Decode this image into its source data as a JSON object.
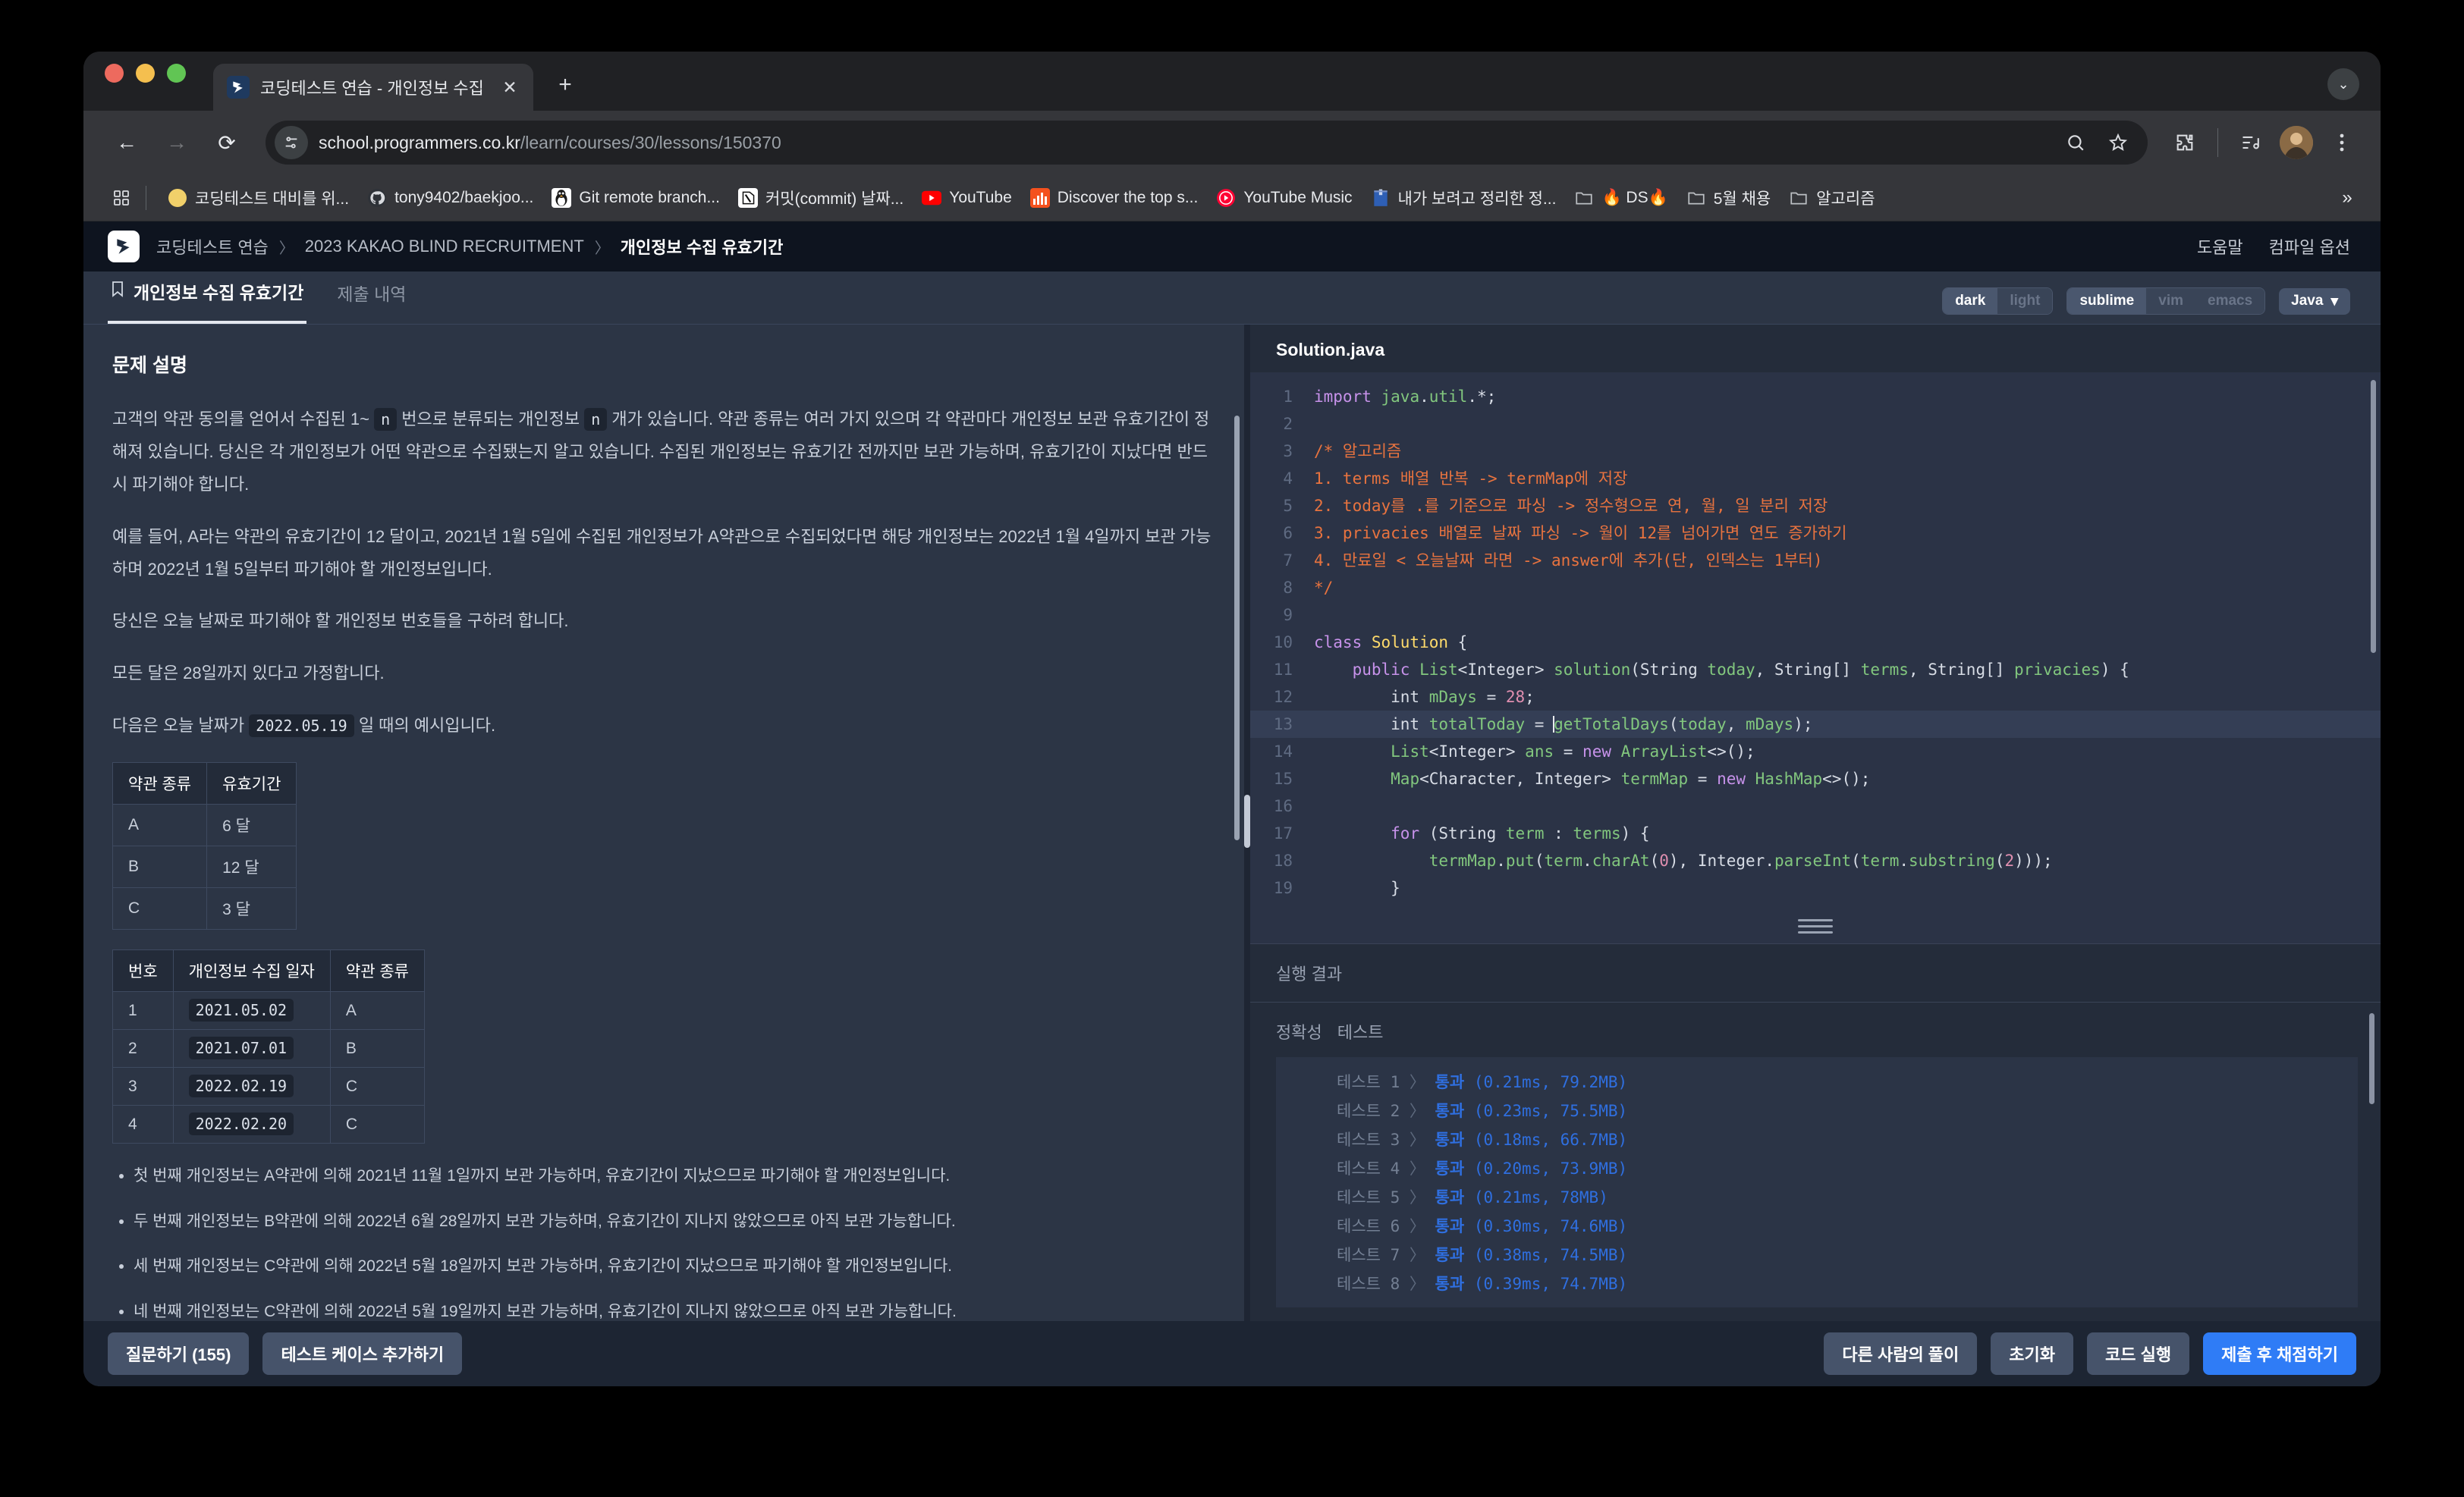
{
  "browser": {
    "tab": {
      "title": "코딩테스트 연습 - 개인정보 수집 유",
      "favicon": "programmers-favicon",
      "close": "✕"
    },
    "newtab_label": "+",
    "tabstrip_more": "⌄",
    "nav": {
      "back": "←",
      "forward": "→",
      "reload": "⟳"
    },
    "omnibox": {
      "host": "school.programmers.co.kr",
      "path": "/learn/courses/30/lessons/150370",
      "site_icon": "site-settings-icon",
      "zoom_icon": "search-icon",
      "bookmark_icon": "star-icon"
    },
    "toolbar_icons": {
      "extensions": "puzzle-icon",
      "media": "media-controls-icon",
      "profile": "avatar-icon",
      "menu": "three-dot-menu-icon"
    },
    "bookmarks": [
      {
        "label": "코딩테스트 대비를 위...",
        "icon": "yellow-circle-icon"
      },
      {
        "label": "tony9402/baekjoo...",
        "icon": "github-icon"
      },
      {
        "label": "Git remote branch...",
        "icon": "tux-icon"
      },
      {
        "label": "커밋(commit) 날짜...",
        "icon": "notion-icon"
      },
      {
        "label": "YouTube",
        "icon": "youtube-icon"
      },
      {
        "label": "Discover the top s...",
        "icon": "orange-chart-icon"
      },
      {
        "label": "YouTube Music",
        "icon": "youtube-music-icon"
      },
      {
        "label": "내가 보려고 정리한 정...",
        "icon": "blue-book-icon"
      },
      {
        "label": "🔥 DS🔥",
        "icon": "folder-icon"
      },
      {
        "label": "5월 채용",
        "icon": "folder-icon"
      },
      {
        "label": "알고리즘",
        "icon": "folder-icon"
      }
    ],
    "bookmarks_overflow": "»",
    "apps_icon": "apps-grid-icon"
  },
  "site": {
    "logo": "programmers-logo",
    "breadcrumb": [
      "코딩테스트 연습",
      "2023 KAKAO BLIND RECRUITMENT",
      "개인정보 수집 유효기간"
    ],
    "breadcrumb_sep": "〉",
    "header_links": [
      "도움말",
      "컴파일 옵션"
    ]
  },
  "page_tabs": [
    {
      "label": "개인정보 수집 유효기간",
      "active": true,
      "icon": "bookmark-icon"
    },
    {
      "label": "제출 내역",
      "active": false
    }
  ],
  "settings": {
    "theme": {
      "options": [
        "dark",
        "light"
      ],
      "selected": "dark"
    },
    "keymap": {
      "options": [
        "sublime",
        "vim",
        "emacs"
      ],
      "selected": "sublime"
    },
    "language": {
      "selected": "Java",
      "caret": "▾"
    }
  },
  "problem": {
    "section_title": "문제 설명",
    "paragraphs": [
      "고객의 약관 동의를 얻어서 수집된 1~ n 번으로 분류되는 개인정보 n 개가 있습니다. 약관 종류는 여러 가지 있으며 각 약관마다 개인정보 보관 유효기간이 정해져 있습니다. 당신은 각 개인정보가 어떤 약관으로 수집됐는지 알고 있습니다. 수집된 개인정보는 유효기간 전까지만 보관 가능하며, 유효기간이 지났다면 반드시 파기해야 합니다.",
      "예를 들어, A라는 약관의 유효기간이 12 달이고, 2021년 1월 5일에 수집된 개인정보가 A약관으로 수집되었다면 해당 개인정보는 2022년 1월 4일까지 보관 가능하며 2022년 1월 5일부터 파기해야 할 개인정보입니다.",
      "당신은 오늘 날짜로 파기해야 할 개인정보 번호들을 구하려 합니다.",
      "모든 달은 28일까지 있다고 가정합니다."
    ],
    "inline_n": "n",
    "example_intro_before": "다음은 오늘 날짜가",
    "example_date": "2022.05.19",
    "example_intro_after": "일 때의 예시입니다.",
    "terms_table": {
      "headers": [
        "약관 종류",
        "유효기간"
      ],
      "rows": [
        [
          "A",
          "6 달"
        ],
        [
          "B",
          "12 달"
        ],
        [
          "C",
          "3 달"
        ]
      ]
    },
    "privacy_table": {
      "headers": [
        "번호",
        "개인정보 수집 일자",
        "약관 종류"
      ],
      "rows": [
        [
          "1",
          "2021.05.02",
          "A"
        ],
        [
          "2",
          "2021.07.01",
          "B"
        ],
        [
          "3",
          "2022.02.19",
          "C"
        ],
        [
          "4",
          "2022.02.20",
          "C"
        ]
      ]
    },
    "notes": [
      "첫 번째 개인정보는 A약관에 의해 2021년 11월 1일까지 보관 가능하며, 유효기간이 지났으므로 파기해야 할 개인정보입니다.",
      "두 번째 개인정보는 B약관에 의해 2022년 6월 28일까지 보관 가능하며, 유효기간이 지나지 않았으므로 아직 보관 가능합니다.",
      "세 번째 개인정보는 C약관에 의해 2022년 5월 18일까지 보관 가능하며, 유효기간이 지났으므로 파기해야 할 개인정보입니다.",
      "네 번째 개인정보는 C약관에 의해 2022년 5월 19일까지 보관 가능하며, 유효기간이 지나지 않았으므로 아직 보관 가능합니다."
    ]
  },
  "editor": {
    "filename": "Solution.java",
    "highlighted_line": 13,
    "lines": [
      {
        "n": 1,
        "tokens": [
          {
            "t": "import ",
            "c": "k"
          },
          {
            "t": "java",
            "c": "t"
          },
          {
            "t": ".",
            "c": "pl"
          },
          {
            "t": "util",
            "c": "t"
          },
          {
            "t": ".*;",
            "c": "pl"
          }
        ]
      },
      {
        "n": 2,
        "tokens": []
      },
      {
        "n": 3,
        "tokens": [
          {
            "t": "/* 알고리즘",
            "c": "cm"
          }
        ]
      },
      {
        "n": 4,
        "tokens": [
          {
            "t": "1. terms 배열 반복 -> termMap에 저장",
            "c": "cm"
          }
        ]
      },
      {
        "n": 5,
        "tokens": [
          {
            "t": "2. today를 .를 기준으로 파싱 -> 정수형으로 연, 월, 일 분리 저장",
            "c": "cm"
          }
        ]
      },
      {
        "n": 6,
        "tokens": [
          {
            "t": "3. privacies 배열로 날짜 파싱 -> 월이 12를 넘어가면 연도 증가하기",
            "c": "cm"
          }
        ]
      },
      {
        "n": 7,
        "tokens": [
          {
            "t": "4. 만료일 < 오늘날짜 라면 -> answer에 추가(단, 인덱스는 1부터)",
            "c": "cm"
          }
        ]
      },
      {
        "n": 8,
        "tokens": [
          {
            "t": "*/",
            "c": "cm"
          }
        ]
      },
      {
        "n": 9,
        "tokens": []
      },
      {
        "n": 10,
        "tokens": [
          {
            "t": "class ",
            "c": "k"
          },
          {
            "t": "Solution",
            "c": "cls"
          },
          {
            "t": " {",
            "c": "pl"
          }
        ]
      },
      {
        "n": 11,
        "tokens": [
          {
            "t": "    ",
            "c": "pl"
          },
          {
            "t": "public ",
            "c": "k"
          },
          {
            "t": "List",
            "c": "t"
          },
          {
            "t": "<Integer> ",
            "c": "pl"
          },
          {
            "t": "solution",
            "c": "t"
          },
          {
            "t": "(String ",
            "c": "pl"
          },
          {
            "t": "today",
            "c": "t"
          },
          {
            "t": ", String[] ",
            "c": "pl"
          },
          {
            "t": "terms",
            "c": "t"
          },
          {
            "t": ", String[] ",
            "c": "pl"
          },
          {
            "t": "privacies",
            "c": "t"
          },
          {
            "t": ") {",
            "c": "pl"
          }
        ]
      },
      {
        "n": 12,
        "tokens": [
          {
            "t": "        int ",
            "c": "pl"
          },
          {
            "t": "mDays",
            "c": "t"
          },
          {
            "t": " = ",
            "c": "pl"
          },
          {
            "t": "28",
            "c": "n"
          },
          {
            "t": ";",
            "c": "pl"
          }
        ]
      },
      {
        "n": 13,
        "tokens": [
          {
            "t": "        int ",
            "c": "pl"
          },
          {
            "t": "totalToday",
            "c": "t"
          },
          {
            "t": " = ",
            "c": "pl"
          },
          {
            "t": "getTotalDays",
            "c": "t"
          },
          {
            "t": "(",
            "c": "pl"
          },
          {
            "t": "today",
            "c": "t"
          },
          {
            "t": ", ",
            "c": "pl"
          },
          {
            "t": "mDays",
            "c": "t"
          },
          {
            "t": ");",
            "c": "pl"
          }
        ]
      },
      {
        "n": 14,
        "tokens": [
          {
            "t": "        ",
            "c": "pl"
          },
          {
            "t": "List",
            "c": "t"
          },
          {
            "t": "<Integer> ",
            "c": "pl"
          },
          {
            "t": "ans",
            "c": "t"
          },
          {
            "t": " = ",
            "c": "pl"
          },
          {
            "t": "new ",
            "c": "k"
          },
          {
            "t": "ArrayList",
            "c": "t"
          },
          {
            "t": "<>();",
            "c": "pl"
          }
        ]
      },
      {
        "n": 15,
        "tokens": [
          {
            "t": "        ",
            "c": "pl"
          },
          {
            "t": "Map",
            "c": "t"
          },
          {
            "t": "<Character, Integer> ",
            "c": "pl"
          },
          {
            "t": "termMap",
            "c": "t"
          },
          {
            "t": " = ",
            "c": "pl"
          },
          {
            "t": "new ",
            "c": "k"
          },
          {
            "t": "HashMap",
            "c": "t"
          },
          {
            "t": "<>();",
            "c": "pl"
          }
        ]
      },
      {
        "n": 16,
        "tokens": []
      },
      {
        "n": 17,
        "tokens": [
          {
            "t": "        ",
            "c": "pl"
          },
          {
            "t": "for ",
            "c": "k"
          },
          {
            "t": "(String ",
            "c": "pl"
          },
          {
            "t": "term",
            "c": "t"
          },
          {
            "t": " : ",
            "c": "pl"
          },
          {
            "t": "terms",
            "c": "t"
          },
          {
            "t": ") {",
            "c": "pl"
          }
        ]
      },
      {
        "n": 18,
        "tokens": [
          {
            "t": "            ",
            "c": "pl"
          },
          {
            "t": "termMap",
            "c": "t"
          },
          {
            "t": ".",
            "c": "pl"
          },
          {
            "t": "put",
            "c": "t"
          },
          {
            "t": "(",
            "c": "pl"
          },
          {
            "t": "term",
            "c": "t"
          },
          {
            "t": ".",
            "c": "pl"
          },
          {
            "t": "charAt",
            "c": "t"
          },
          {
            "t": "(",
            "c": "pl"
          },
          {
            "t": "0",
            "c": "n"
          },
          {
            "t": "), Integer.",
            "c": "pl"
          },
          {
            "t": "parseInt",
            "c": "t"
          },
          {
            "t": "(",
            "c": "pl"
          },
          {
            "t": "term",
            "c": "t"
          },
          {
            "t": ".",
            "c": "pl"
          },
          {
            "t": "substring",
            "c": "t"
          },
          {
            "t": "(",
            "c": "pl"
          },
          {
            "t": "2",
            "c": "n"
          },
          {
            "t": ")));",
            "c": "pl"
          }
        ]
      },
      {
        "n": 19,
        "tokens": [
          {
            "t": "        }",
            "c": "pl"
          }
        ]
      }
    ]
  },
  "results": {
    "run_result_label": "실행 결과",
    "tabs": [
      "정확성",
      "테스트"
    ],
    "rows": [
      {
        "name": "테스트 1",
        "chev": "〉",
        "status": "통과",
        "metrics": "(0.21ms, 79.2MB)"
      },
      {
        "name": "테스트 2",
        "chev": "〉",
        "status": "통과",
        "metrics": "(0.23ms, 75.5MB)"
      },
      {
        "name": "테스트 3",
        "chev": "〉",
        "status": "통과",
        "metrics": "(0.18ms, 66.7MB)"
      },
      {
        "name": "테스트 4",
        "chev": "〉",
        "status": "통과",
        "metrics": "(0.20ms, 73.9MB)"
      },
      {
        "name": "테스트 5",
        "chev": "〉",
        "status": "통과",
        "metrics": "(0.21ms, 78MB)"
      },
      {
        "name": "테스트 6",
        "chev": "〉",
        "status": "통과",
        "metrics": "(0.30ms, 74.6MB)"
      },
      {
        "name": "테스트 7",
        "chev": "〉",
        "status": "통과",
        "metrics": "(0.38ms, 74.5MB)"
      },
      {
        "name": "테스트 8",
        "chev": "〉",
        "status": "통과",
        "metrics": "(0.39ms, 74.7MB)"
      }
    ]
  },
  "actions": {
    "left": [
      "질문하기 (155)",
      "테스트 케이스 추가하기"
    ],
    "right": [
      "다른 사람의 풀이",
      "초기화",
      "코드 실행"
    ],
    "primary": "제출 후 채점하기"
  },
  "colors": {
    "accent": "#2f7cf6",
    "page_bg": "#2c3545",
    "editor_bg": "#2b3346",
    "pass": "#2f6fe0"
  }
}
